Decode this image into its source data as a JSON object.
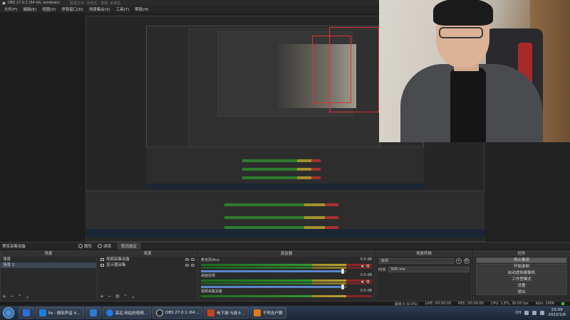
{
  "window": {
    "title": "OBS 27.0.1 (64-bit, windows)",
    "title_extra": "· 配置文件: 未命名 · 场景: 未命名"
  },
  "menu": [
    "文件(F)",
    "编辑(E)",
    "视图(V)",
    "停靠窗口(D)",
    "场景集合(S)",
    "工具(T)",
    "帮助(H)"
  ],
  "docks_bar": {
    "label": "预览采集设备",
    "properties": "属性",
    "filters": "滤镜",
    "deselect": "取消选定"
  },
  "scenes": {
    "title": "场景",
    "items": [
      "场景",
      "场景 2"
    ],
    "selected": 1
  },
  "sources": {
    "title": "来源",
    "items": [
      {
        "name": "视频采集设备",
        "icon": "camera-icon"
      },
      {
        "name": "显示器采集",
        "icon": "monitor-icon"
      }
    ]
  },
  "mixer": {
    "title": "混音器",
    "channels": [
      {
        "name": "麦克风/Aux",
        "db": "0.0 dB",
        "level": 0.97
      },
      {
        "name": "桌面音频",
        "db": "0.0 dB",
        "level": 0.97
      },
      {
        "name": "视频采集设备",
        "db": "0.0 dB",
        "level": 0.97
      }
    ]
  },
  "transitions": {
    "title": "场景转换",
    "current": "淡出",
    "duration_label": "时长",
    "duration_value": "300 ms"
  },
  "controls": {
    "title": "控件",
    "buttons": [
      "停止推流",
      "开始录制",
      "启动虚拟摄像机",
      "工作室模式",
      "设置",
      "退出"
    ]
  },
  "status": {
    "dropped": "丢帧 0 (0.0%)",
    "live": "LIVE: 00:00:00",
    "rec": "REC: 00:00:00",
    "cpu": "CPU: 1.8%, 30.00 fps",
    "kbps": "kb/s: 2906"
  },
  "taskbar": {
    "items": [
      {
        "label": "",
        "icon": "app-icon",
        "color": "#2a6fd1"
      },
      {
        "label": "Pa - 微软声音 A...",
        "icon": "app-icon",
        "color": "#1c7fd6"
      },
      {
        "label": "",
        "icon": "folder-icon",
        "color": "#2d7bd3"
      },
      {
        "label": "高远 网站的视频...",
        "icon": "browser-icon",
        "color": "#1f7bdc"
      },
      {
        "label": "OBS 27.0.1 (64...",
        "icon": "obs-icon",
        "color": "#2a2a2a"
      },
      {
        "label": "电下城 与兹士...",
        "icon": "media-icon",
        "color": "#c7421d"
      },
      {
        "label": "千阿吉户赛",
        "icon": "game-icon",
        "color": "#e07b18"
      }
    ],
    "clock_time": "23:09",
    "clock_date": "2022/1/6",
    "lang": "CH"
  }
}
